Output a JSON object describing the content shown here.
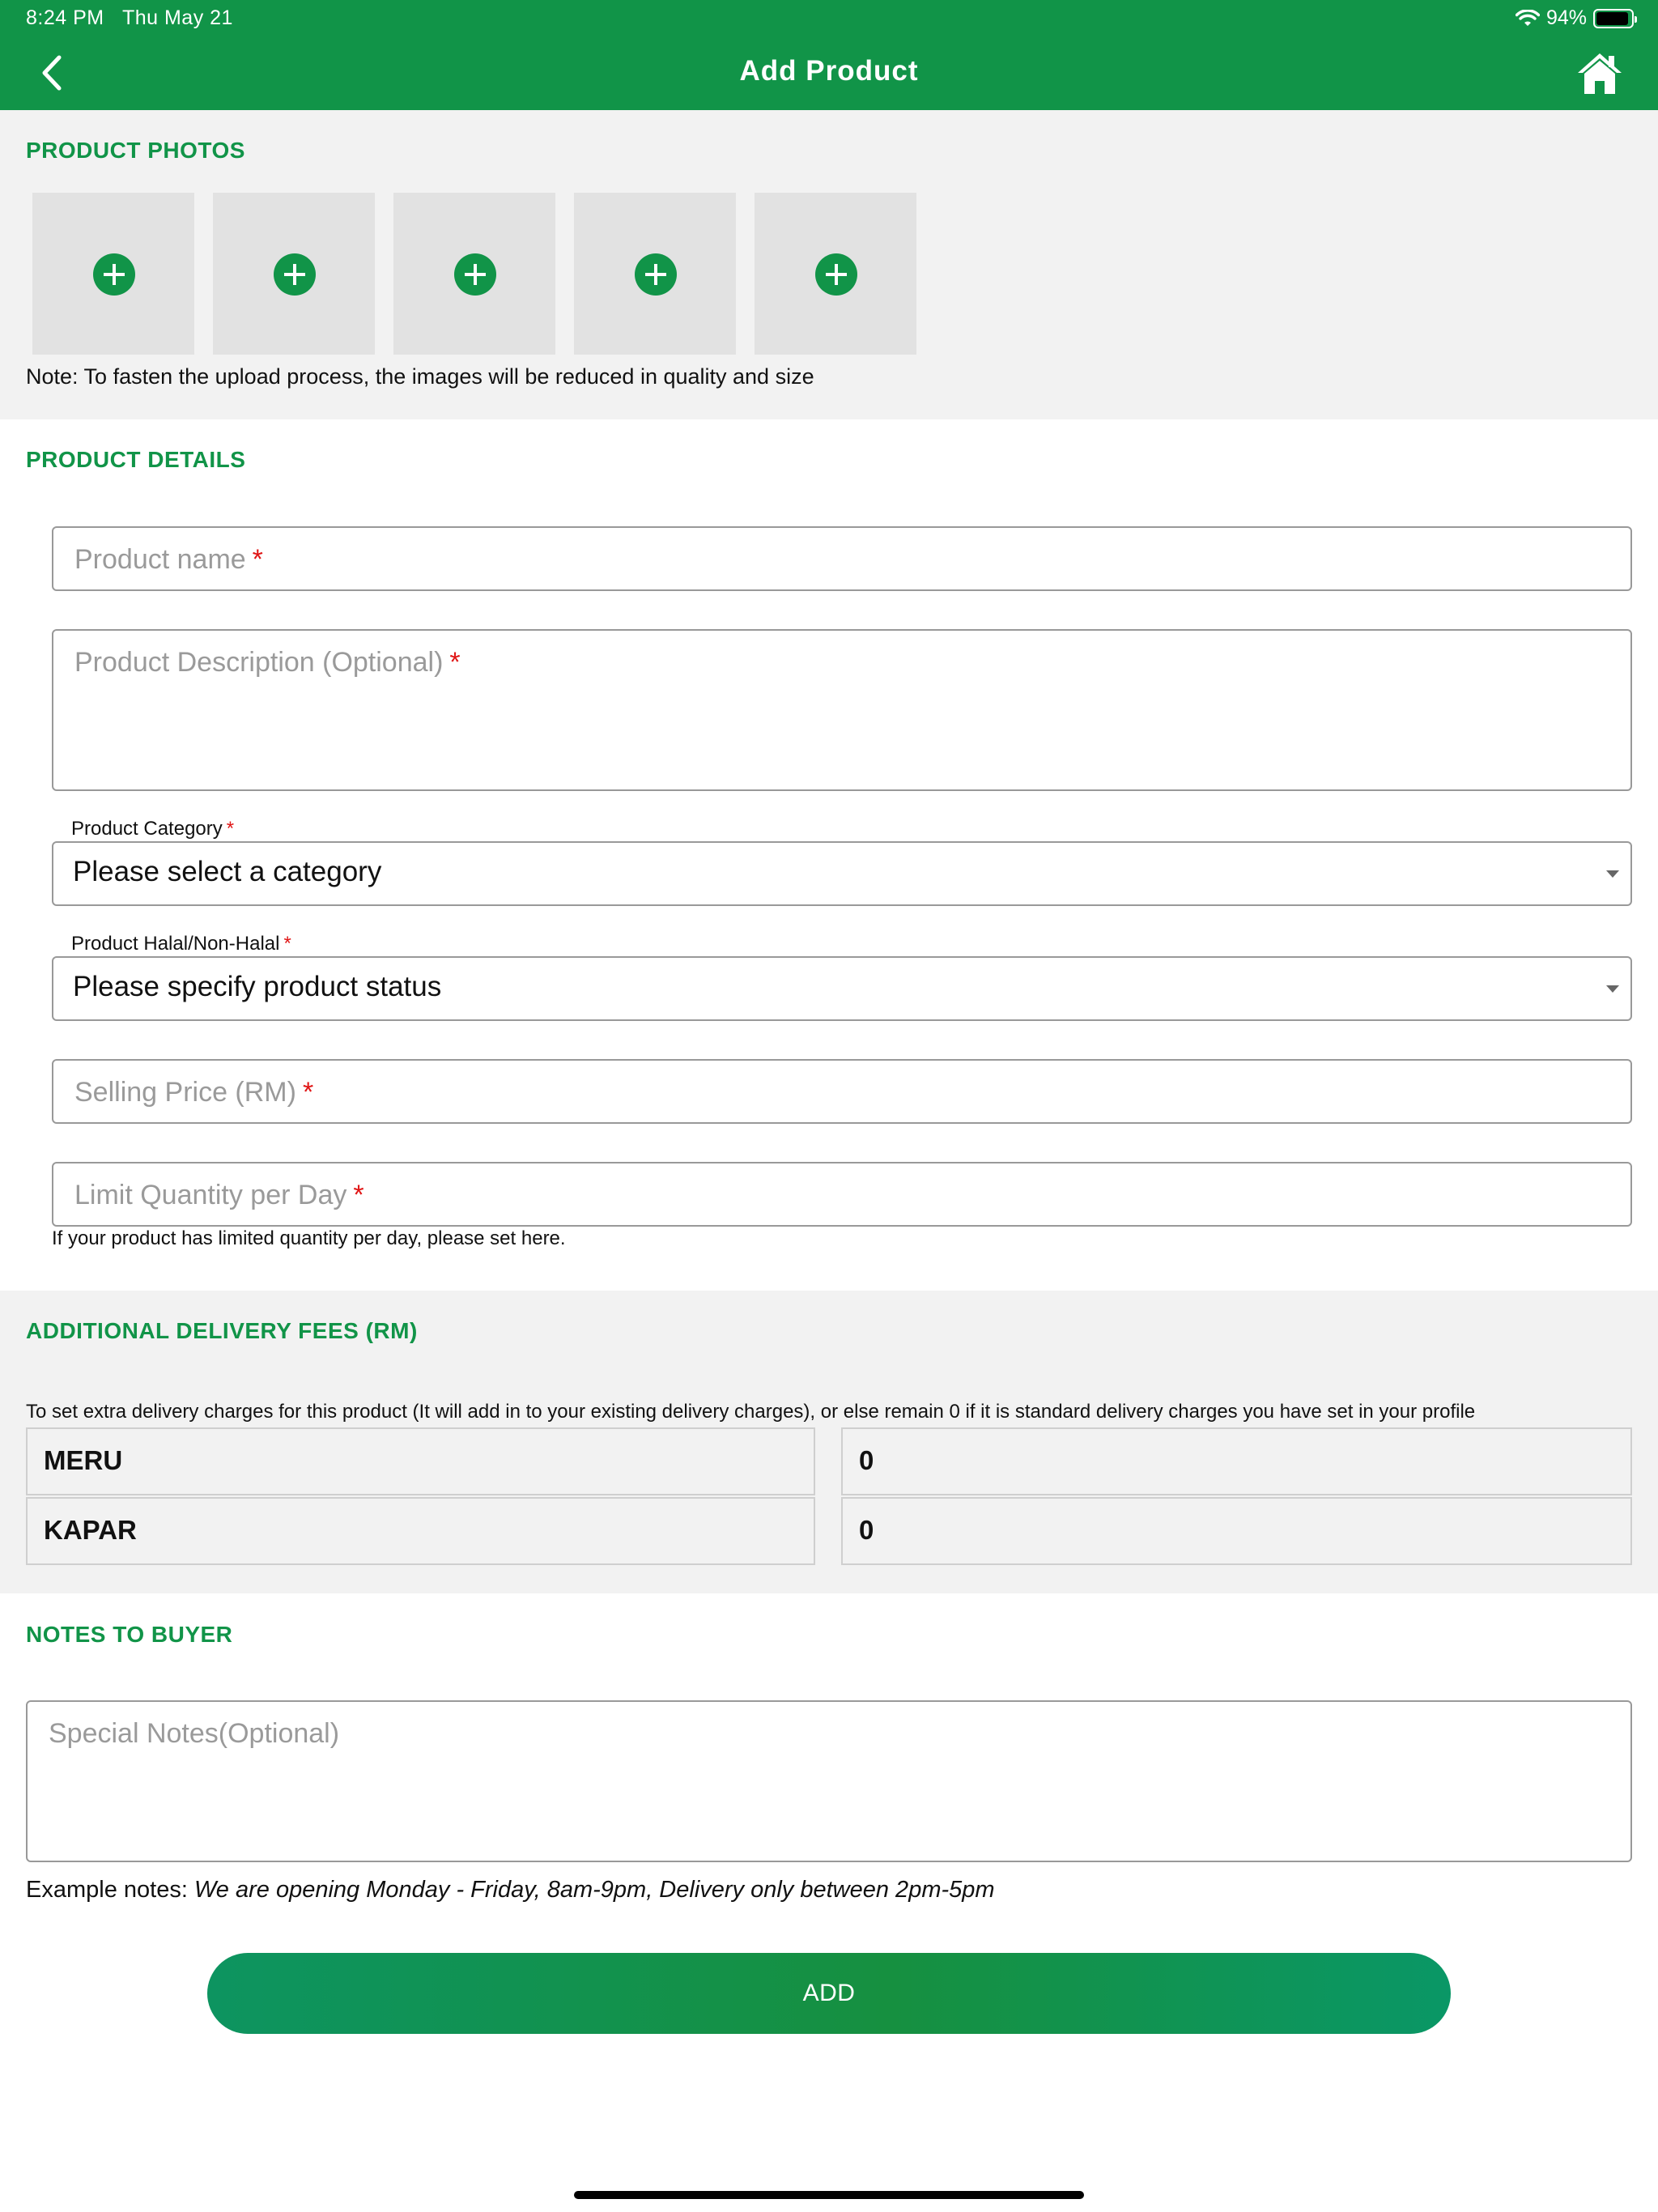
{
  "status_bar": {
    "time": "8:24 PM",
    "date": "Thu May 21",
    "battery": "94%",
    "battery_level": 0.94
  },
  "header": {
    "title": "Add Product",
    "background_color": "#119448",
    "back_icon": "chevron-left-icon",
    "home_icon": "home-icon"
  },
  "photos": {
    "title": "PRODUCT PHOTOS",
    "slots": 5,
    "note": "Note: To fasten the upload process, the images will be reduced in quality and size"
  },
  "details": {
    "title": "PRODUCT DETAILS",
    "required_mark": "*",
    "product_name_placeholder": "Product name",
    "description_placeholder": "Product Description (Optional)",
    "category_label": "Product Category",
    "category_value": "Please select a category",
    "halal_label": "Product Halal/Non-Halal",
    "halal_value": "Please specify product status",
    "price_placeholder": "Selling Price (RM)",
    "limit_placeholder": "Limit Quantity per Day",
    "limit_help": "If your product has limited quantity per day, please set here."
  },
  "delivery": {
    "title": "ADDITIONAL DELIVERY FEES (RM)",
    "description": "To set extra delivery charges for this product (It will add in to your existing delivery charges), or else remain 0 if it is standard delivery charges you have set in your profile",
    "rows": [
      {
        "area": "MERU",
        "fee": "0"
      },
      {
        "area": "KAPAR",
        "fee": "0"
      }
    ]
  },
  "notes": {
    "title": "NOTES TO BUYER",
    "placeholder": "Special Notes(Optional)",
    "example_label": "Example notes:",
    "example_text": "We are opening Monday - Friday, 8am-9pm, Delivery only between 2pm-5pm"
  },
  "add_button": {
    "label": "ADD"
  }
}
